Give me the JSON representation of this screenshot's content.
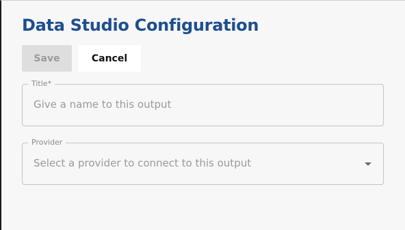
{
  "header": {
    "title": "Data Studio Configuration"
  },
  "toolbar": {
    "save_label": "Save",
    "cancel_label": "Cancel"
  },
  "form": {
    "title_field": {
      "label": "Title*",
      "placeholder": "Give a name to this output"
    },
    "provider_field": {
      "label": "Provider",
      "placeholder": "Select a provider to connect to this output"
    }
  },
  "icons": {
    "provider_dropdown": "caret-down-icon"
  },
  "colors": {
    "title": "#1d4f8f",
    "save_disabled_bg": "#dedede",
    "save_disabled_text": "#9b9b9b"
  }
}
